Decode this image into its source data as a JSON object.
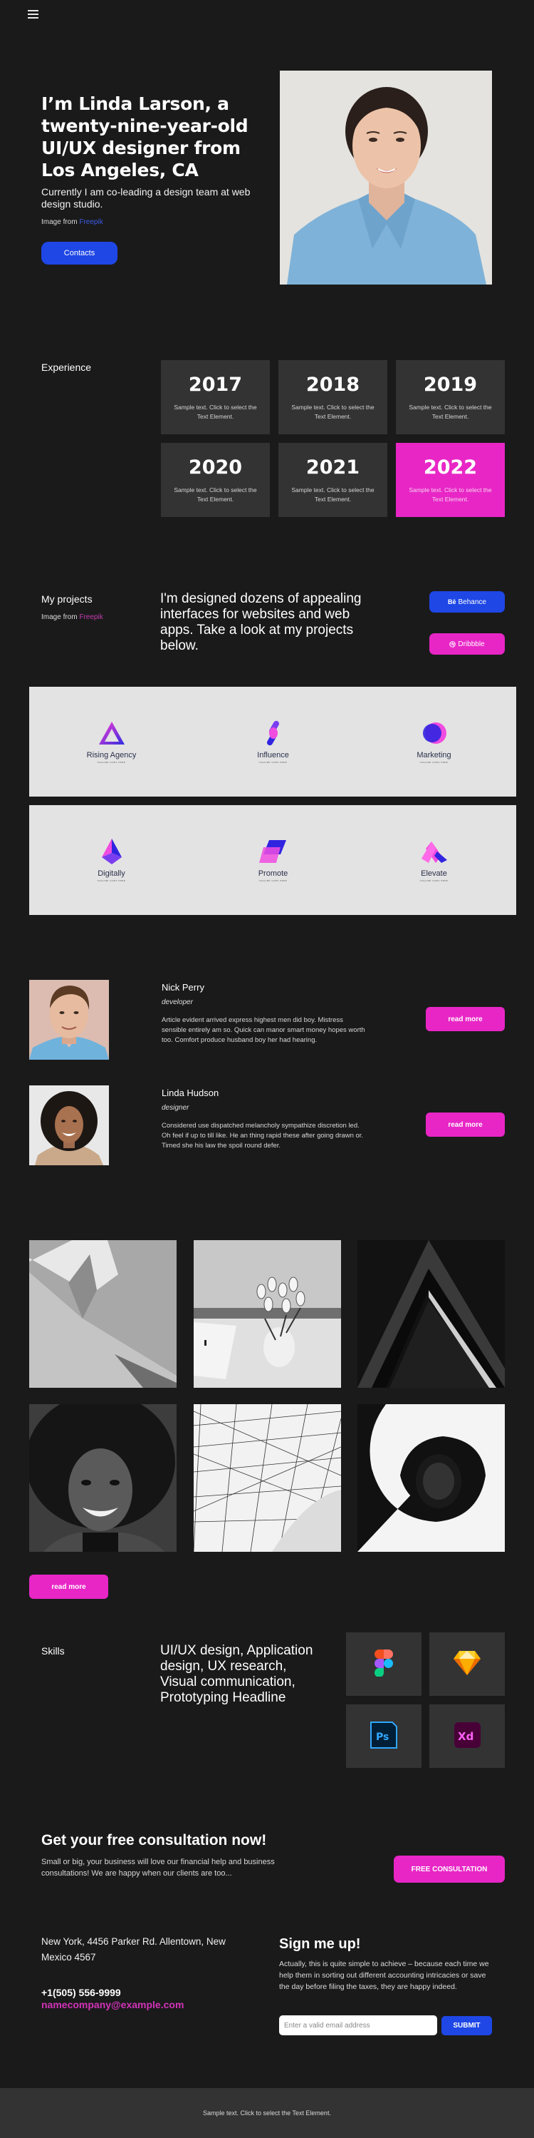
{
  "nav": {
    "menu_icon": "hamburger-menu-icon"
  },
  "hero": {
    "title": "I’m Linda Larson, a twenty-nine-year-old UI/UX designer from Los Angeles, CA",
    "subtitle": "Currently I am co-leading a design team at web design studio.",
    "credit_prefix": "Image from",
    "credit_link": "Freepik",
    "contacts_button": "Contacts",
    "photo_alt": "Portrait of smiling woman in denim shirt"
  },
  "experience": {
    "label": "Experience",
    "items": [
      {
        "year": "2017",
        "text": "Sample text. Click to select the Text Element."
      },
      {
        "year": "2018",
        "text": "Sample text. Click to select the Text Element."
      },
      {
        "year": "2019",
        "text": "Sample text. Click to select the Text Element."
      },
      {
        "year": "2020",
        "text": "Sample text. Click to select the Text Element."
      },
      {
        "year": "2021",
        "text": "Sample text. Click to select the Text Element."
      },
      {
        "year": "2022",
        "text": "Sample text. Click to select the Text Element.",
        "active": true
      }
    ]
  },
  "projects": {
    "label": "My projects",
    "credit_prefix": "Image from",
    "credit_link": "Freepik",
    "headline": "I'm designed dozens of appealing interfaces for websites and web apps. Take a look at my projects below.",
    "behance_button": "Behance",
    "behance_icon": "Bē",
    "dribbble_button": "Dribbble",
    "items": [
      {
        "name": "Rising Agency",
        "tagline": "TAGLINE GOES HERE"
      },
      {
        "name": "Influence",
        "tagline": "TAGLINE GOES HERE"
      },
      {
        "name": "Marketing",
        "tagline": "TAGLINE GOES HERE"
      },
      {
        "name": "Digitally",
        "tagline": "TAGLINE GOES HERE"
      },
      {
        "name": "Promote",
        "tagline": "TAGLINE GOES HERE"
      },
      {
        "name": "Elevate",
        "tagline": "TAGLINE GOES HERE"
      }
    ]
  },
  "team": [
    {
      "name": "Nick Perry",
      "role": "developer",
      "bio": "Article evident arrived express highest men did boy. Mistress sensible entirely am so. Quick can manor smart money hopes worth too. Comfort produce husband boy her had hearing.",
      "button": "read more"
    },
    {
      "name": "Linda Hudson",
      "role": "designer",
      "bio": "Considered use dispatched melancholy sympathize discretion led. Oh feel if up to till like. He an thing rapid these after going drawn or. Timed she his law the spoil round defer.",
      "button": "read more"
    }
  ],
  "gallery": {
    "button": "read more"
  },
  "skills": {
    "label": "Skills",
    "headline": "UI/UX design, Application design, UX research, Visual communication, Prototyping Headline",
    "tools": [
      "Figma",
      "Sketch",
      "Ps",
      "Xd"
    ]
  },
  "consultation": {
    "title": "Get your free consultation now!",
    "text": "Small or big, your business will love our financial help and business consultations! We are happy when our clients are too...",
    "button": "FREE CONSULTATION"
  },
  "contact": {
    "address": "New York, 4456 Parker Rd. Allentown, New Mexico 4567",
    "phone": "+1(505) 556-9999",
    "email": "namecompany@example.com"
  },
  "signup": {
    "title": "Sign me up!",
    "text": "Actually, this is quite simple to achieve – because each time we help them in sorting out different accounting intricacies or save the day before filing the taxes, they are happy indeed.",
    "email_placeholder": "Enter a valid email address",
    "email_value": "",
    "submit": "SUBMIT"
  },
  "footer": {
    "text": "Sample text. Click to select the Text Element."
  },
  "colors": {
    "background": "#1a1a1a",
    "tile": "#333333",
    "accent_pink": "#e826c6",
    "accent_blue": "#1e47e6",
    "link_blue": "#3b5ce6",
    "link_pink": "#d233b9"
  }
}
